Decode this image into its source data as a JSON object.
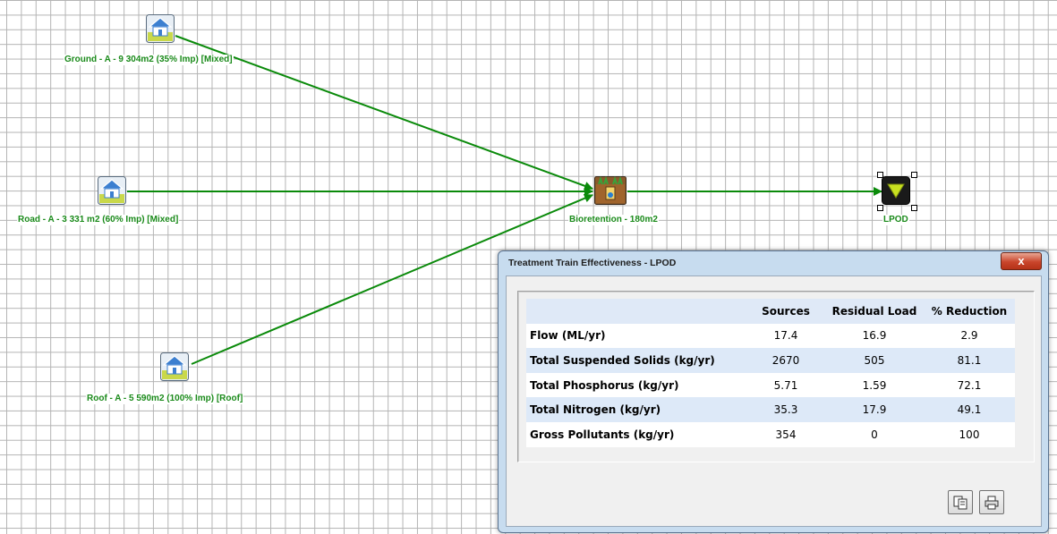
{
  "nodes": {
    "ground": {
      "label": "Ground - A - 9 304m2 (35% Imp) [Mixed]",
      "icon": "house-source-icon"
    },
    "road": {
      "label": "Road - A - 3 331 m2 (60% Imp) [Mixed]",
      "icon": "house-source-icon"
    },
    "roof": {
      "label": "Roof - A - 5 590m2 (100% Imp) [Roof]",
      "icon": "house-source-icon"
    },
    "bioretention": {
      "label": "Bioretention - 180m2",
      "icon": "bioretention-icon"
    },
    "lpod": {
      "label": "LPOD",
      "icon": "receiving-node-icon"
    }
  },
  "colors": {
    "link": "#0a8a0a",
    "label": "#1a8a1a",
    "grid": "#b4b4b4"
  },
  "dialog": {
    "title": "Treatment Train Effectiveness - LPOD",
    "close_label": "x",
    "table": {
      "headers": [
        "",
        "Sources",
        "Residual Load",
        "% Reduction"
      ],
      "rows": [
        {
          "name": "Flow (ML/yr)",
          "sources": "17.4",
          "residual": "16.9",
          "reduction": "2.9"
        },
        {
          "name": "Total Suspended Solids (kg/yr)",
          "sources": "2670",
          "residual": "505",
          "reduction": "81.1"
        },
        {
          "name": "Total Phosphorus (kg/yr)",
          "sources": "5.71",
          "residual": "1.59",
          "reduction": "72.1"
        },
        {
          "name": "Total Nitrogen (kg/yr)",
          "sources": "35.3",
          "residual": "17.9",
          "reduction": "49.1"
        },
        {
          "name": "Gross Pollutants (kg/yr)",
          "sources": "354",
          "residual": "0",
          "reduction": "100"
        }
      ]
    },
    "buttons": {
      "copy": "copy-icon",
      "print": "printer-icon"
    }
  }
}
